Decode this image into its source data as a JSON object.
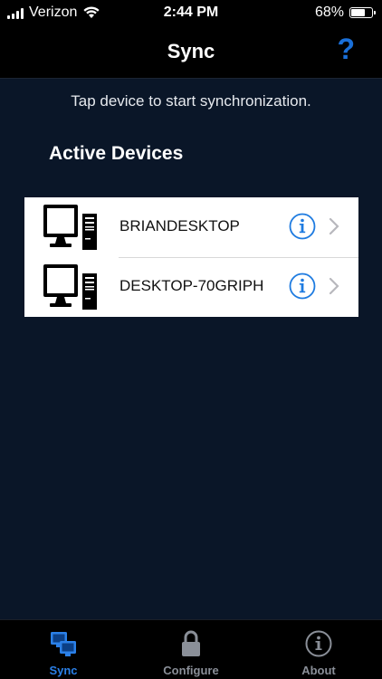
{
  "status_bar": {
    "carrier": "Verizon",
    "time": "2:44 PM",
    "battery_percent": "68%",
    "battery_level": 0.68,
    "icons": [
      "signal-icon",
      "wifi-icon",
      "battery-icon"
    ]
  },
  "nav": {
    "title": "Sync",
    "help_label": "?"
  },
  "instruction": "Tap device to start synchronization.",
  "section_title": "Active Devices",
  "devices": [
    {
      "name": "BRIANDESKTOP",
      "icon": "desktop-computer-icon"
    },
    {
      "name": "DESKTOP-70GRIPH",
      "icon": "desktop-computer-icon"
    }
  ],
  "tabs": [
    {
      "label": "Sync",
      "icon": "sync-computers-icon",
      "active": true
    },
    {
      "label": "Configure",
      "icon": "lock-icon",
      "active": false
    },
    {
      "label": "About",
      "icon": "info-icon",
      "active": false
    }
  ],
  "colors": {
    "background": "#0a1628",
    "bar": "#000000",
    "accent": "#2b80e8",
    "inactive_tab": "#8a8f98",
    "info_blue": "#1e7be0"
  }
}
